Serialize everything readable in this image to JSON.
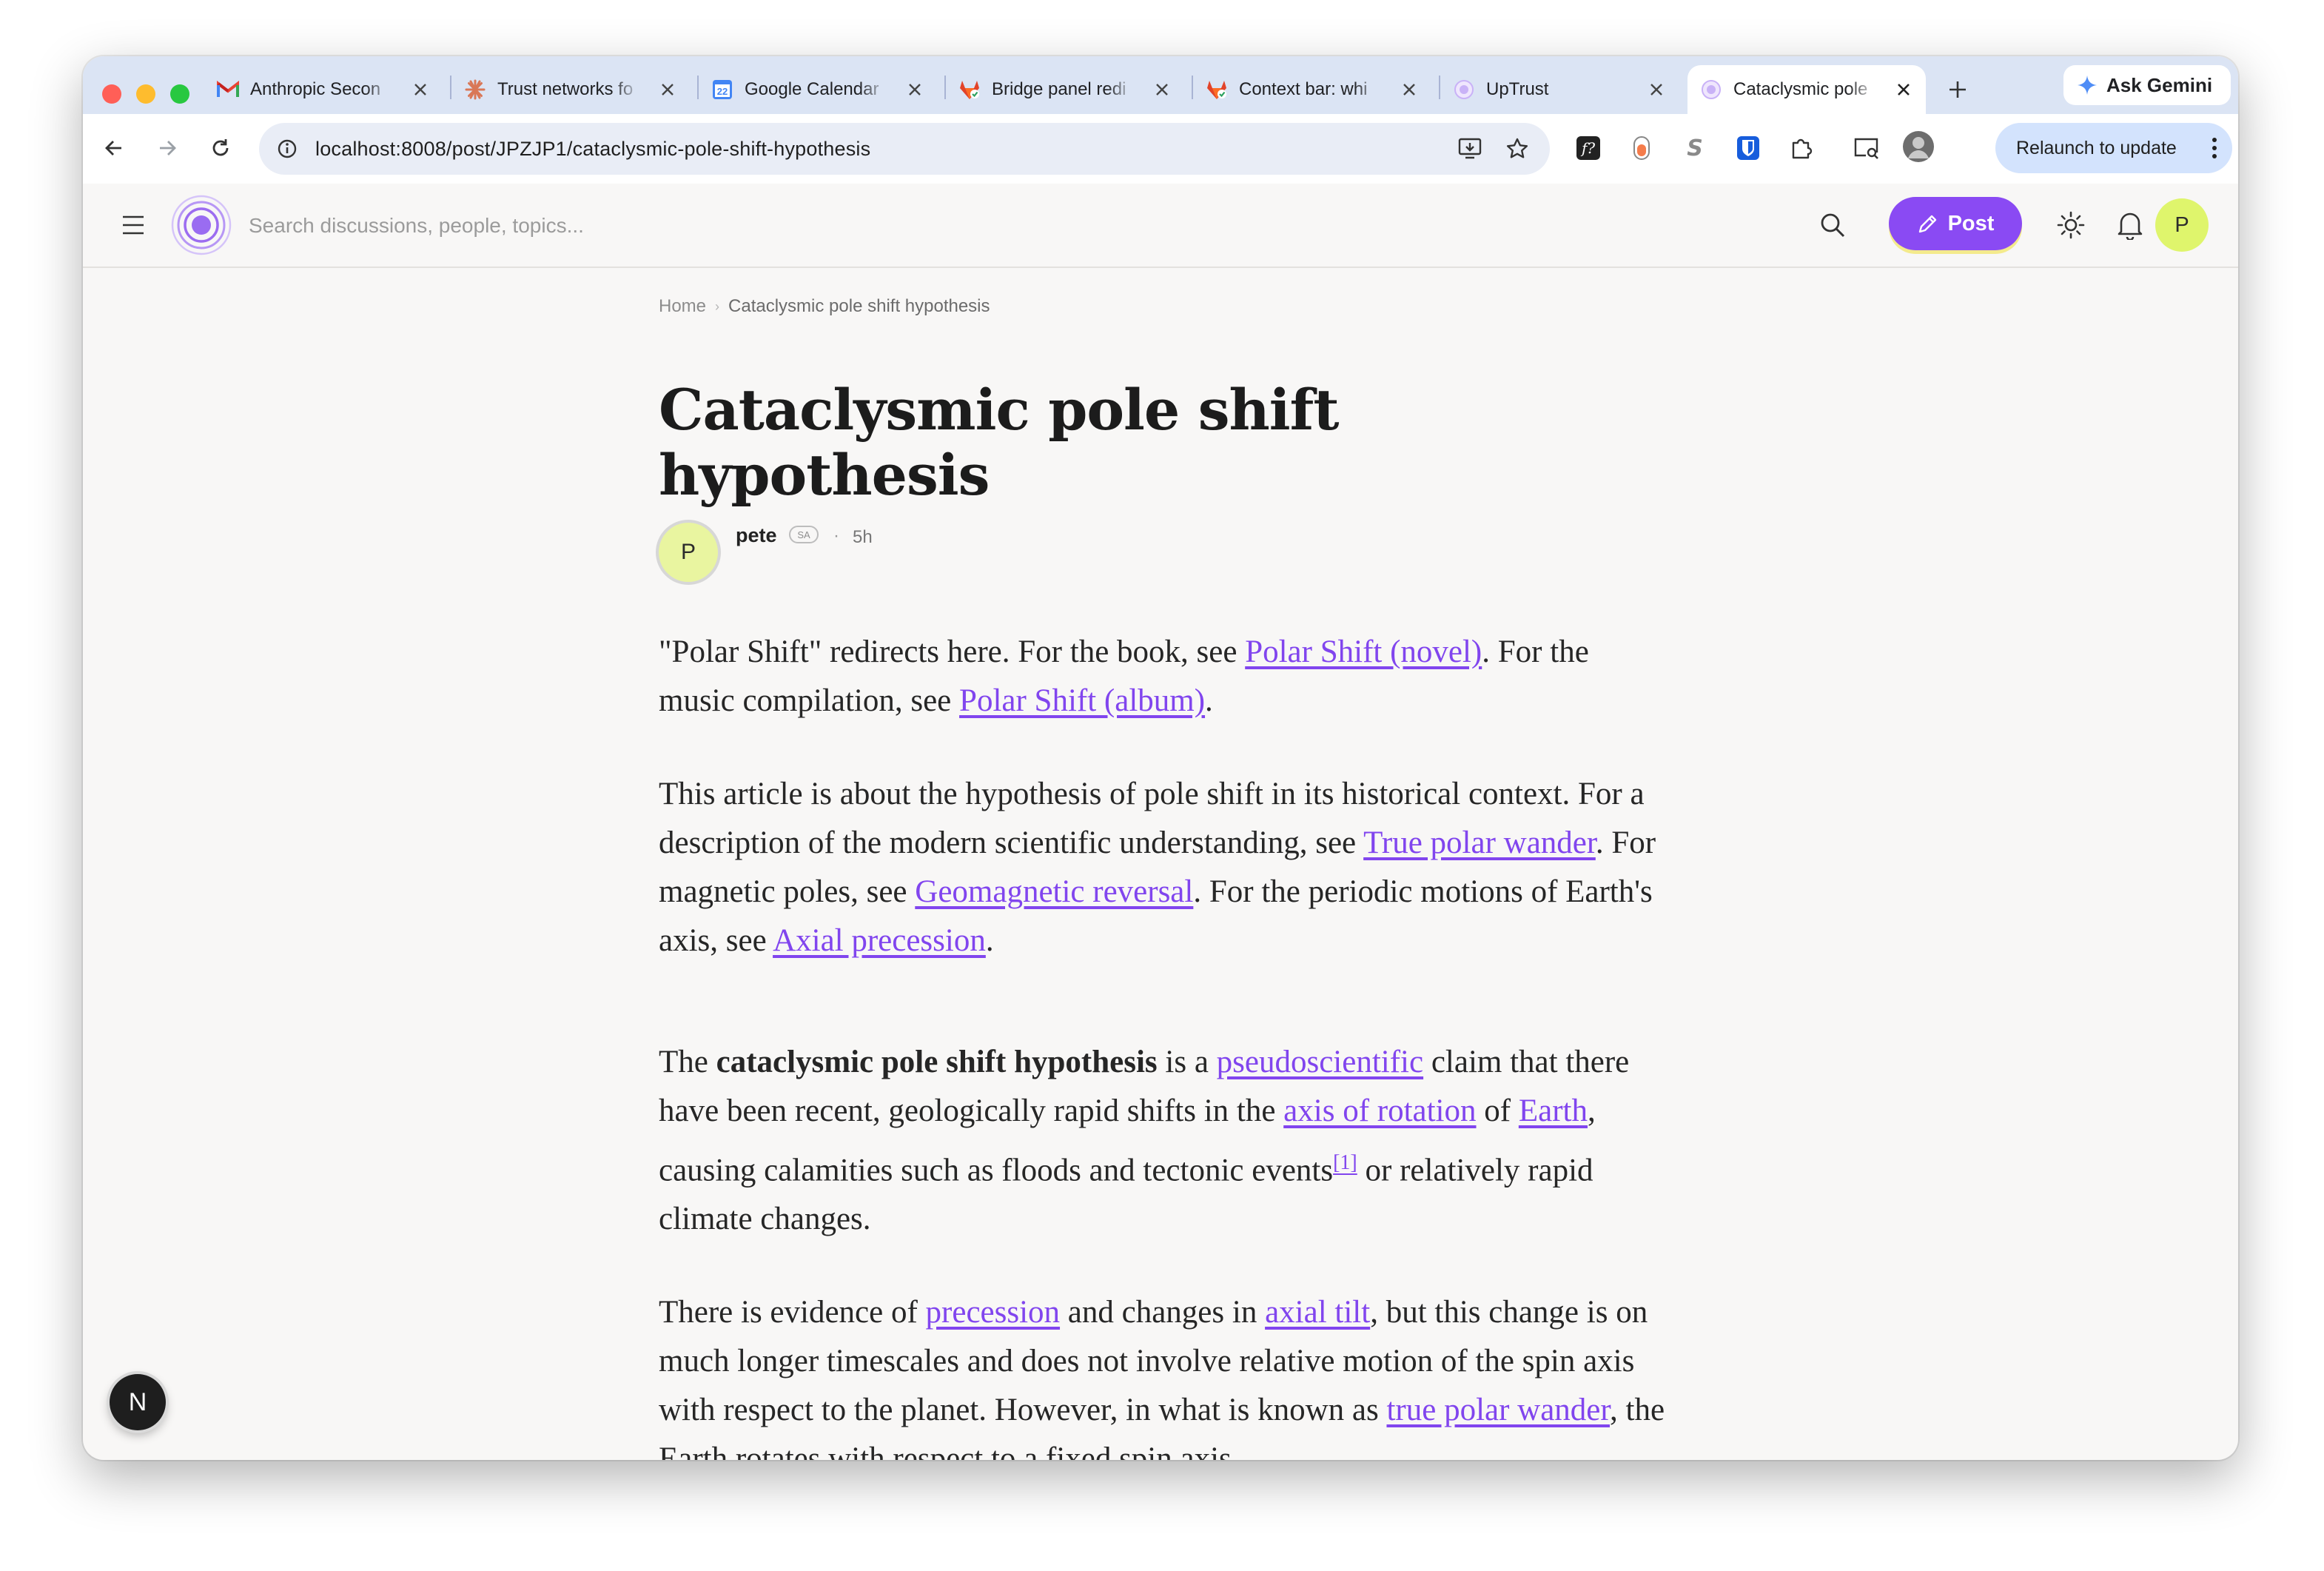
{
  "browser": {
    "tabs": [
      {
        "title": "Anthropic Secon",
        "icon": "gmail-icon"
      },
      {
        "title": "Trust networks fo",
        "icon": "claude-icon"
      },
      {
        "title": "Google Calendar",
        "icon": "google-calendar-icon",
        "calendar_day": "22"
      },
      {
        "title": "Bridge panel redi",
        "icon": "gitlab-icon"
      },
      {
        "title": "Context bar: whi",
        "icon": "gitlab-icon"
      },
      {
        "title": "UpTrust",
        "icon": "uptrust-icon"
      },
      {
        "title": "Cataclysmic pole",
        "icon": "uptrust-icon",
        "active": true
      }
    ],
    "ask_gemini_label": "Ask Gemini",
    "url": "localhost:8008/post/JPZJP1/cataclysmic-pole-shift-hypothesis",
    "relaunch_label": "Relaunch to update",
    "colors": {
      "tabstrip": "#dbe4f4",
      "traffic_red": "#ff5f57",
      "traffic_yellow": "#febc2e",
      "traffic_green": "#28c840"
    }
  },
  "app": {
    "search_placeholder": "Search discussions, people, topics...",
    "post_label": "Post",
    "user_initial": "P",
    "colors": {
      "accent": "#8a4af3",
      "avatar": "#dff56c",
      "link": "#8145ee"
    }
  },
  "breadcrumb": {
    "home": "Home",
    "current": "Cataclysmic pole shift hypothesis"
  },
  "post": {
    "title": "Cataclysmic pole shift hypothesis",
    "author": "pete",
    "author_initial": "P",
    "author_badge": "SA",
    "time": "5h",
    "paragraphs": {
      "p1": {
        "t1": "\"Polar Shift\" redirects here. For the book, see ",
        "l1": "Polar Shift (novel)",
        "t2": ". For the music compilation, see ",
        "l2": "Polar Shift (album)",
        "t3": "."
      },
      "p2": {
        "t1": "This article is about the hypothesis of pole shift in its historical context. For a description of the modern scientific understanding, see ",
        "l1": "True polar wander",
        "t2": ". For magnetic poles, see ",
        "l2": "Geomagnetic reversal",
        "t3": ". For the periodic motions of Earth's axis, see ",
        "l3": "Axial precession",
        "t4": "."
      },
      "p3": {
        "t1": "The ",
        "b1": "cataclysmic pole shift hypothesis",
        "t2": " is a ",
        "l1": "pseudoscientific",
        "t3": " claim that there have been recent, geologically rapid shifts in the ",
        "l2": "axis of rotation",
        "t4": " of ",
        "l3": "Earth",
        "t5": ", causing calamities such as floods and tectonic events",
        "ref": "[1]",
        "t6": " or relatively rapid climate changes."
      },
      "p4": {
        "t1": "There is evidence of ",
        "l1": "precession",
        "t2": " and changes in ",
        "l2": "axial tilt",
        "t3": ", but this change is on much longer timescales and does not involve relative motion of the spin axis with respect to the planet. However, in what is known as ",
        "l3": "true polar wander",
        "t4": ", the Earth rotates with respect to a fixed spin axis."
      }
    }
  },
  "dev_badge": "N"
}
